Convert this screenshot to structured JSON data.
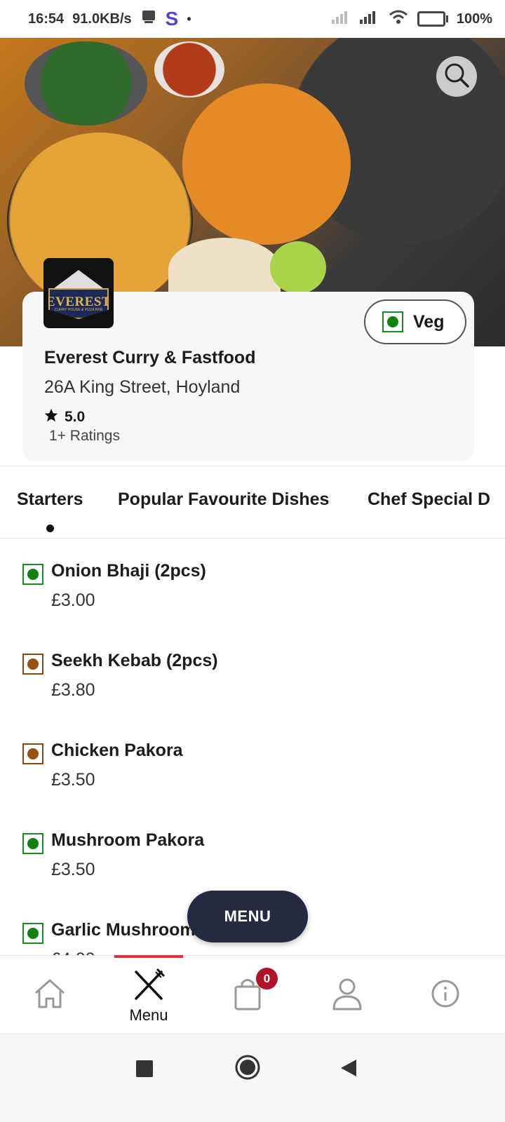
{
  "status_bar": {
    "time": "16:54",
    "net_speed": "91.0KB/s",
    "app_letter": "S",
    "dot": "•",
    "battery_level": "100%"
  },
  "hero": {
    "search_icon": "search-icon"
  },
  "restaurant": {
    "name": "Everest Curry & Fastfood",
    "address": "26A King Street, Hoyland",
    "rating": "5.0",
    "ratings_count": "1+ Ratings",
    "logo": {
      "wordmark": "EVEREST",
      "subtitle": "CURRY HOUSE & PIZZA BAR"
    }
  },
  "filter": {
    "veg_label": "Veg"
  },
  "categories": [
    {
      "label": "Starters",
      "active": true
    },
    {
      "label": "Popular Favourite Dishes",
      "active": false
    },
    {
      "label": "Chef Special D",
      "active": false
    }
  ],
  "menu_items": [
    {
      "name": "Onion Bhaji (2pcs)",
      "price": "£3.00",
      "type": "veg"
    },
    {
      "name": "Seekh Kebab (2pcs)",
      "price": "£3.80",
      "type": "non-veg"
    },
    {
      "name": "Chicken Pakora",
      "price": "£3.50",
      "type": "non-veg"
    },
    {
      "name": "Mushroom Pakora",
      "price": "£3.50",
      "type": "veg"
    },
    {
      "name": "Garlic Mushroom",
      "price": "£4.00",
      "type": "veg"
    }
  ],
  "fab": {
    "label": "MENU"
  },
  "bottom_nav": {
    "items": [
      {
        "icon": "home-icon",
        "label": ""
      },
      {
        "icon": "fork-knife-icon",
        "label": "Menu"
      },
      {
        "icon": "shopping-bag-icon",
        "label": ""
      },
      {
        "icon": "user-icon",
        "label": ""
      },
      {
        "icon": "info-icon",
        "label": ""
      }
    ],
    "cart_count": "0"
  },
  "colors": {
    "veg_green": "#108010",
    "nonveg_brown": "#9a4f14",
    "fab_bg": "#242a3f",
    "active_indicator": "#e0303a",
    "badge": "#b0122a"
  }
}
